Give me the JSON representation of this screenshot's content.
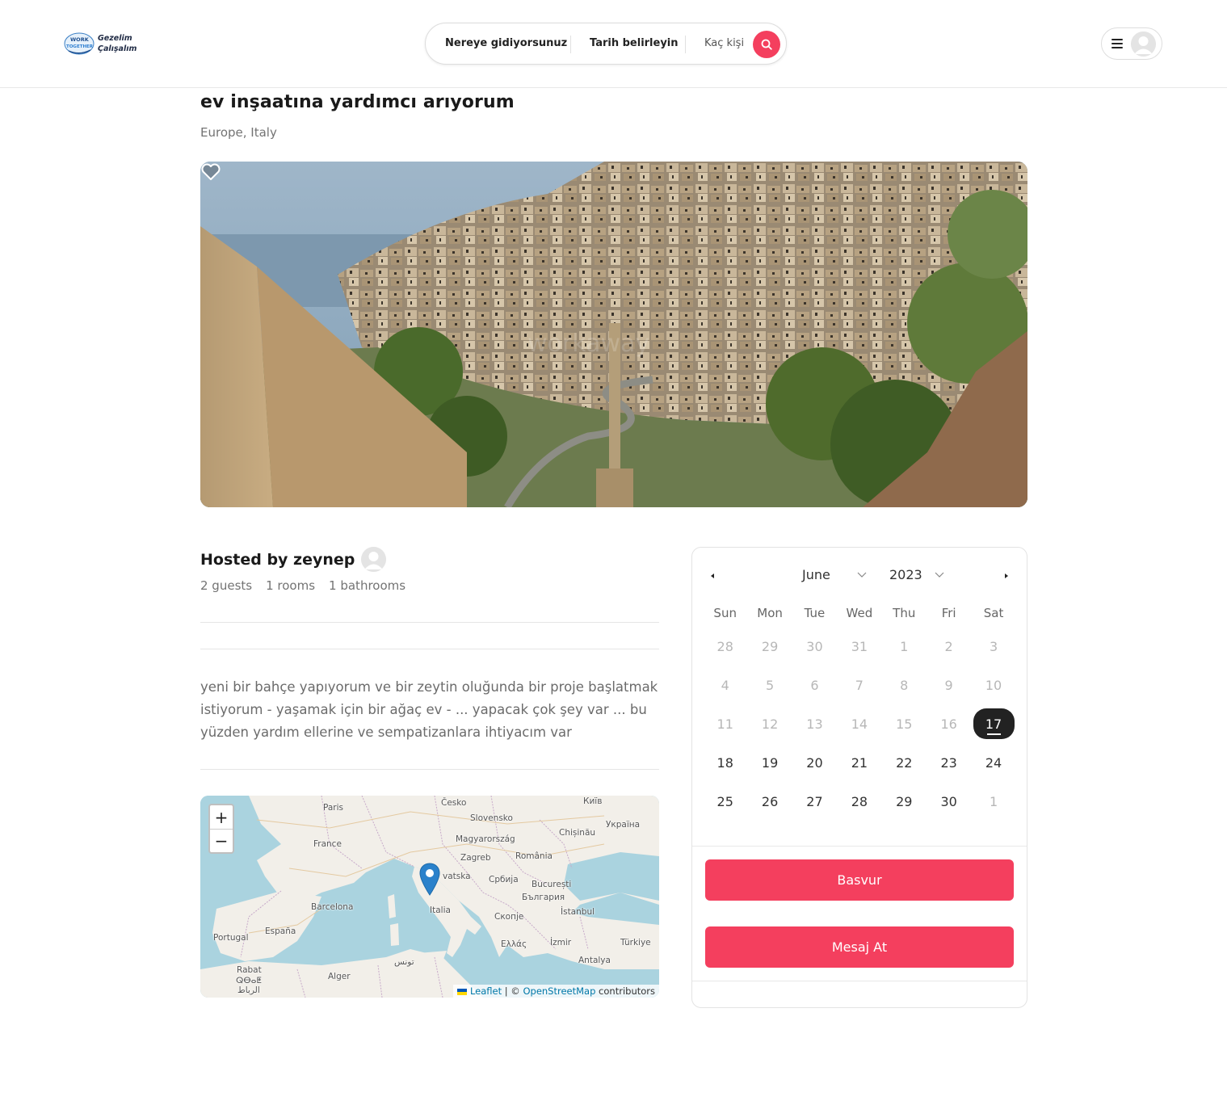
{
  "header": {
    "logo_text_line1": "Gezelim",
    "logo_text_line2": "Çalışalım",
    "logo_badge_line1": "WORK",
    "logo_badge_line2": "TOGETHER",
    "search": {
      "where_label": "Nereye gidiyorsunuz",
      "date_label": "Tarih belirleyin",
      "guests_label": "Kaç kişi"
    },
    "icons": {
      "search": "search-icon",
      "menu": "menu-icon",
      "avatar": "avatar"
    }
  },
  "listing": {
    "title": "ev inşaatına yardımcı arıyorum",
    "location": "Europe, Italy",
    "image_watermark": "workaway",
    "host_label": "Hosted by zeynep",
    "guests": "2 guests",
    "rooms": "1 rooms",
    "bathrooms": "1 bathrooms",
    "description": "yeni bir bahçe yapıyorum ve bir zeytin oluğunda bir proje başlatmak istiyorum - yaşamak için bir ağaç ev - ... yapacak çok şey var ... bu yüzden yardım ellerine ve sempatizanlara ihtiyacım var"
  },
  "map": {
    "zoom_in": "+",
    "zoom_out": "−",
    "attribution_leaflet": "Leaflet",
    "attribution_sep": " | © ",
    "attribution_osm": "OpenStreetMap",
    "attribution_tail": " contributors",
    "labels": {
      "paris": "Paris",
      "cesko": "Česko",
      "kyiv": "Київ",
      "slovensko": "Slovensko",
      "ukraina": "Україна",
      "chisinau": "Chișinău",
      "france": "France",
      "magyarorszag": "Magyarország",
      "zagreb": "Zagreb",
      "romania": "România",
      "hrvatska": "vatska",
      "srbija": "Србија",
      "bucuresti": "București",
      "bulgaria": "България",
      "barcelona": "Barcelona",
      "italia": "Italia",
      "skopje": "Скопје",
      "istanbul": "İstanbul",
      "portugal": "Portugal",
      "espana": "España",
      "ellas": "Ελλάς",
      "izmir": "İzmir",
      "turkiye": "Türkiye",
      "tunis": "تونس",
      "antalya": "Antalya",
      "rabat": "Rabat",
      "rabat2": "ⵕⴱⴰⵟ",
      "rabat3": "الرباط",
      "alger": "Alger"
    }
  },
  "calendar": {
    "month": "June",
    "year": "2023",
    "weekdays": [
      "Sun",
      "Mon",
      "Tue",
      "Wed",
      "Thu",
      "Fri",
      "Sat"
    ],
    "weeks": [
      [
        "28",
        "29",
        "30",
        "31",
        "1",
        "2",
        "3"
      ],
      [
        "4",
        "5",
        "6",
        "7",
        "8",
        "9",
        "10"
      ],
      [
        "11",
        "12",
        "13",
        "14",
        "15",
        "16",
        "17"
      ],
      [
        "18",
        "19",
        "20",
        "21",
        "22",
        "23",
        "24"
      ],
      [
        "25",
        "26",
        "27",
        "28",
        "29",
        "30",
        "1"
      ]
    ],
    "selected": "17"
  },
  "actions": {
    "apply": "Basvur",
    "message": "Mesaj At"
  },
  "colors": {
    "accent": "#f43f5e",
    "selected_day": "#222222",
    "muted_text": "#737373"
  }
}
